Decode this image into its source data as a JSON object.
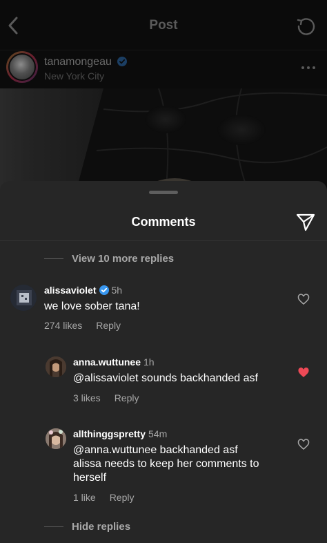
{
  "header": {
    "title": "Post",
    "back_icon": "chevron-left-icon",
    "refresh_icon": "refresh-icon"
  },
  "post": {
    "username": "tanamongeau",
    "verified": true,
    "location": "New York City",
    "more_icon": "ellipsis-icon"
  },
  "sheet": {
    "title": "Comments",
    "share_icon": "send-icon"
  },
  "view_more_replies": "View 10 more replies",
  "comments": [
    {
      "username": "alissaviolet",
      "verified": true,
      "time": "5h",
      "text": "we love sober tana!",
      "likes": "274 likes",
      "reply": "Reply",
      "liked": false
    },
    {
      "username": "anna.wuttunee",
      "verified": false,
      "time": "1h",
      "text": "@alissaviolet sounds backhanded asf",
      "likes": "3 likes",
      "reply": "Reply",
      "liked": true
    },
    {
      "username": "allthinggspretty",
      "verified": false,
      "time": "54m",
      "text_lines": [
        "@anna.wuttunee backhanded asf",
        "alissa needs to keep her comments to",
        "herself"
      ],
      "likes": "1 like",
      "reply": "Reply",
      "liked": false
    }
  ],
  "hide_replies": "Hide replies",
  "colors": {
    "verified_blue": "#3897f0",
    "like_red": "#ed4956",
    "sheet_bg": "#262626"
  }
}
